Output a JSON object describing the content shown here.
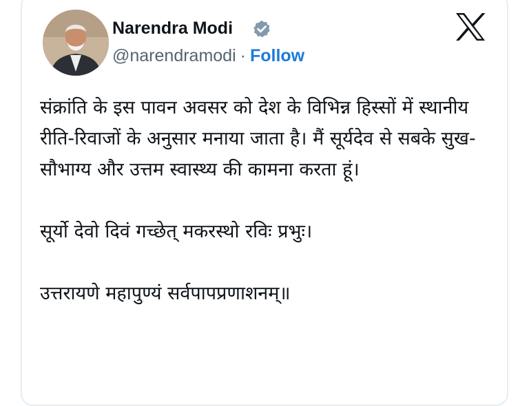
{
  "tweet": {
    "author": {
      "name": "Narendra Modi",
      "handle": "@narendramodi",
      "separator": "·",
      "follow_label": "Follow",
      "verified_icon": "verified-badge-icon",
      "verified_color": "#829aab"
    },
    "platform_icon": "x-logo-icon",
    "body": [
      "संक्रांति के इस पावन अवसर को देश के विभिन्न हिस्सों में स्थानीय रीति-रिवाजों के अनुसार मनाया जाता है। मैं सूर्यदेव से सबके सुख-सौभाग्य और उत्तम स्वास्थ्य की कामना करता हूं।",
      "सूर्यो देवो दिवं गच्छेत् मकरस्थो रविः प्रभुः।",
      "उत्तरायणे महापुण्यं सर्वपापप्रणाशनम्॥"
    ]
  },
  "colors": {
    "text": "#0f1419",
    "secondary": "#536471",
    "link": "#1d7bd8",
    "card_border": "#e6ecf0"
  }
}
